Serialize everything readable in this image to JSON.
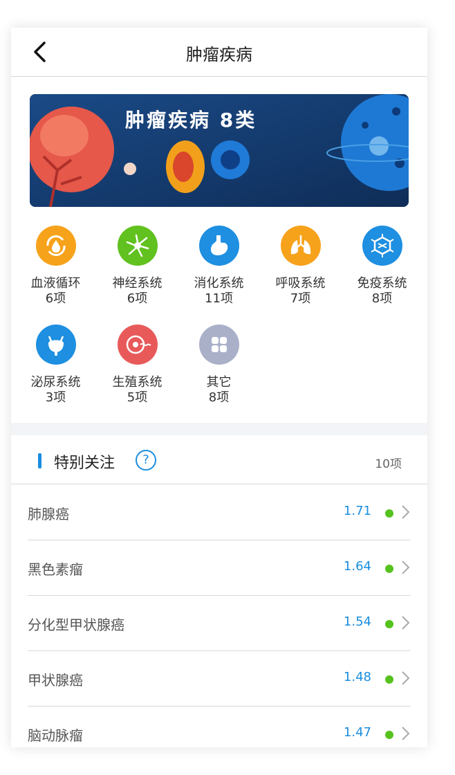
{
  "nav": {
    "title": "肿瘤疾病"
  },
  "banner": {
    "title": "肿瘤疾病  8类"
  },
  "categories": [
    {
      "name": "血液循环",
      "count": "6项",
      "icon": "blood-drop-icon",
      "color": "#f7a21b"
    },
    {
      "name": "神经系统",
      "count": "6项",
      "icon": "neuron-icon",
      "color": "#61c11f"
    },
    {
      "name": "消化系统",
      "count": "11项",
      "icon": "stomach-icon",
      "color": "#1e8fe1"
    },
    {
      "name": "呼吸系统",
      "count": "7项",
      "icon": "lungs-icon",
      "color": "#f7a21b"
    },
    {
      "name": "免疫系统",
      "count": "8项",
      "icon": "immune-cell-icon",
      "color": "#1e8fe1"
    },
    {
      "name": "泌尿系统",
      "count": "3项",
      "icon": "bladder-icon",
      "color": "#1e8fe1"
    },
    {
      "name": "生殖系统",
      "count": "5项",
      "icon": "reproduction-icon",
      "color": "#e85a5a"
    },
    {
      "name": "其它",
      "count": "8项",
      "icon": "grid-icon",
      "color": "#a9b0c8"
    }
  ],
  "section": {
    "title": "特别关注",
    "help": "?",
    "count": "10项"
  },
  "rows": [
    {
      "label": "肺腺癌",
      "value": "1.71"
    },
    {
      "label": "黑色素瘤",
      "value": "1.64"
    },
    {
      "label": "分化型甲状腺癌",
      "value": "1.54"
    },
    {
      "label": "甲状腺癌",
      "value": "1.48"
    },
    {
      "label": "脑动脉瘤",
      "value": "1.47"
    }
  ]
}
